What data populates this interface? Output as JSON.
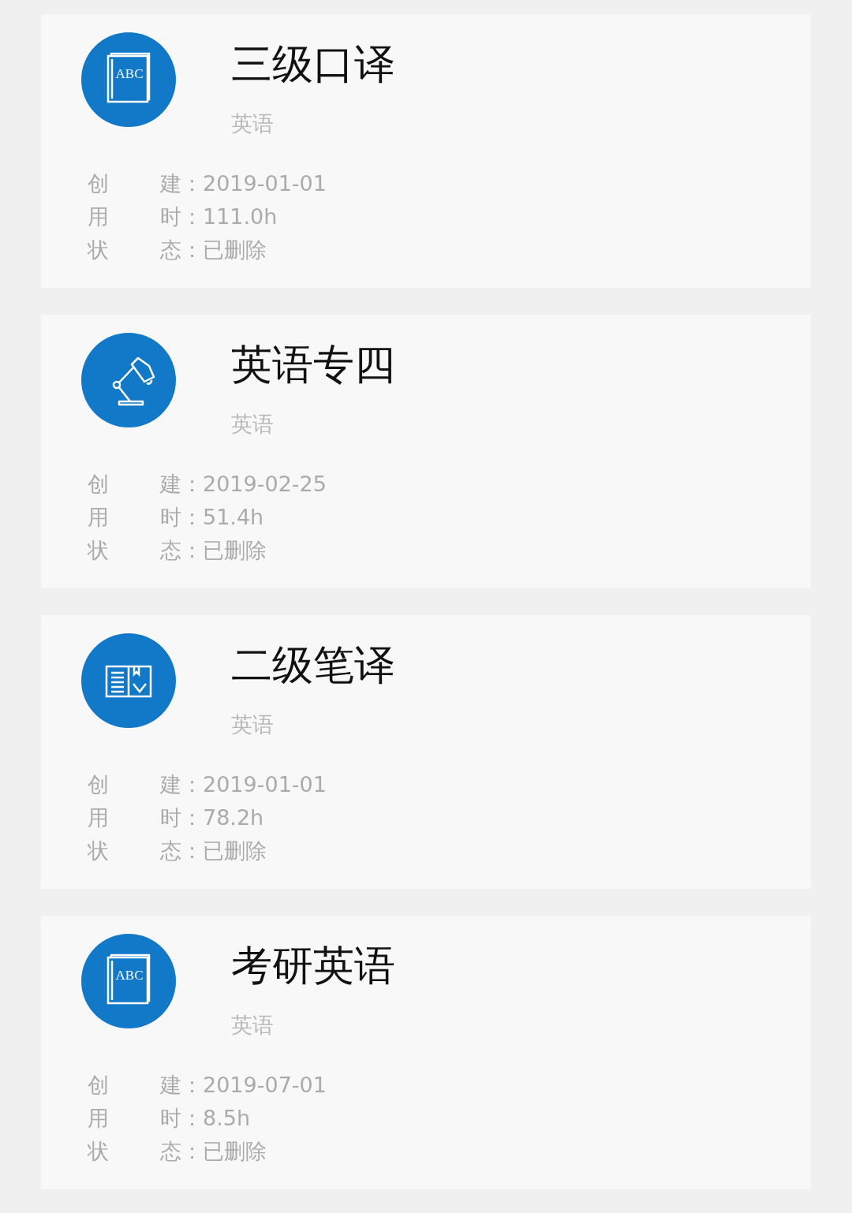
{
  "courses": [
    {
      "title": "三级口译",
      "subject": "英语",
      "icon": {
        "kind": "book",
        "text": "ABC"
      },
      "details": [
        {
          "label": [
            "创",
            "建："
          ],
          "value": "2019-01-01"
        },
        {
          "label": [
            "用",
            "时："
          ],
          "value": "111.0h"
        },
        {
          "label": [
            "状",
            "态："
          ],
          "value": "已删除"
        }
      ]
    },
    {
      "title": "英语专四",
      "subject": "英语",
      "icon": {
        "kind": "lamp"
      },
      "details": [
        {
          "label": [
            "创",
            "建："
          ],
          "value": "2019-02-25"
        },
        {
          "label": [
            "用",
            "时："
          ],
          "value": "51.4h"
        },
        {
          "label": [
            "状",
            "态："
          ],
          "value": "已删除"
        }
      ]
    },
    {
      "title": "二级笔译",
      "subject": "英语",
      "icon": {
        "kind": "open-book"
      },
      "details": [
        {
          "label": [
            "创",
            "建："
          ],
          "value": "2019-01-01"
        },
        {
          "label": [
            "用",
            "时："
          ],
          "value": "78.2h"
        },
        {
          "label": [
            "状",
            "态："
          ],
          "value": "已删除"
        }
      ]
    },
    {
      "title": "考研英语",
      "subject": "英语",
      "icon": {
        "kind": "book",
        "text": "ABC"
      },
      "details": [
        {
          "label": [
            "创",
            "建："
          ],
          "value": "2019-07-01"
        },
        {
          "label": [
            "用",
            "时："
          ],
          "value": "8.5h"
        },
        {
          "label": [
            "状",
            "态："
          ],
          "value": "已删除"
        }
      ]
    }
  ]
}
